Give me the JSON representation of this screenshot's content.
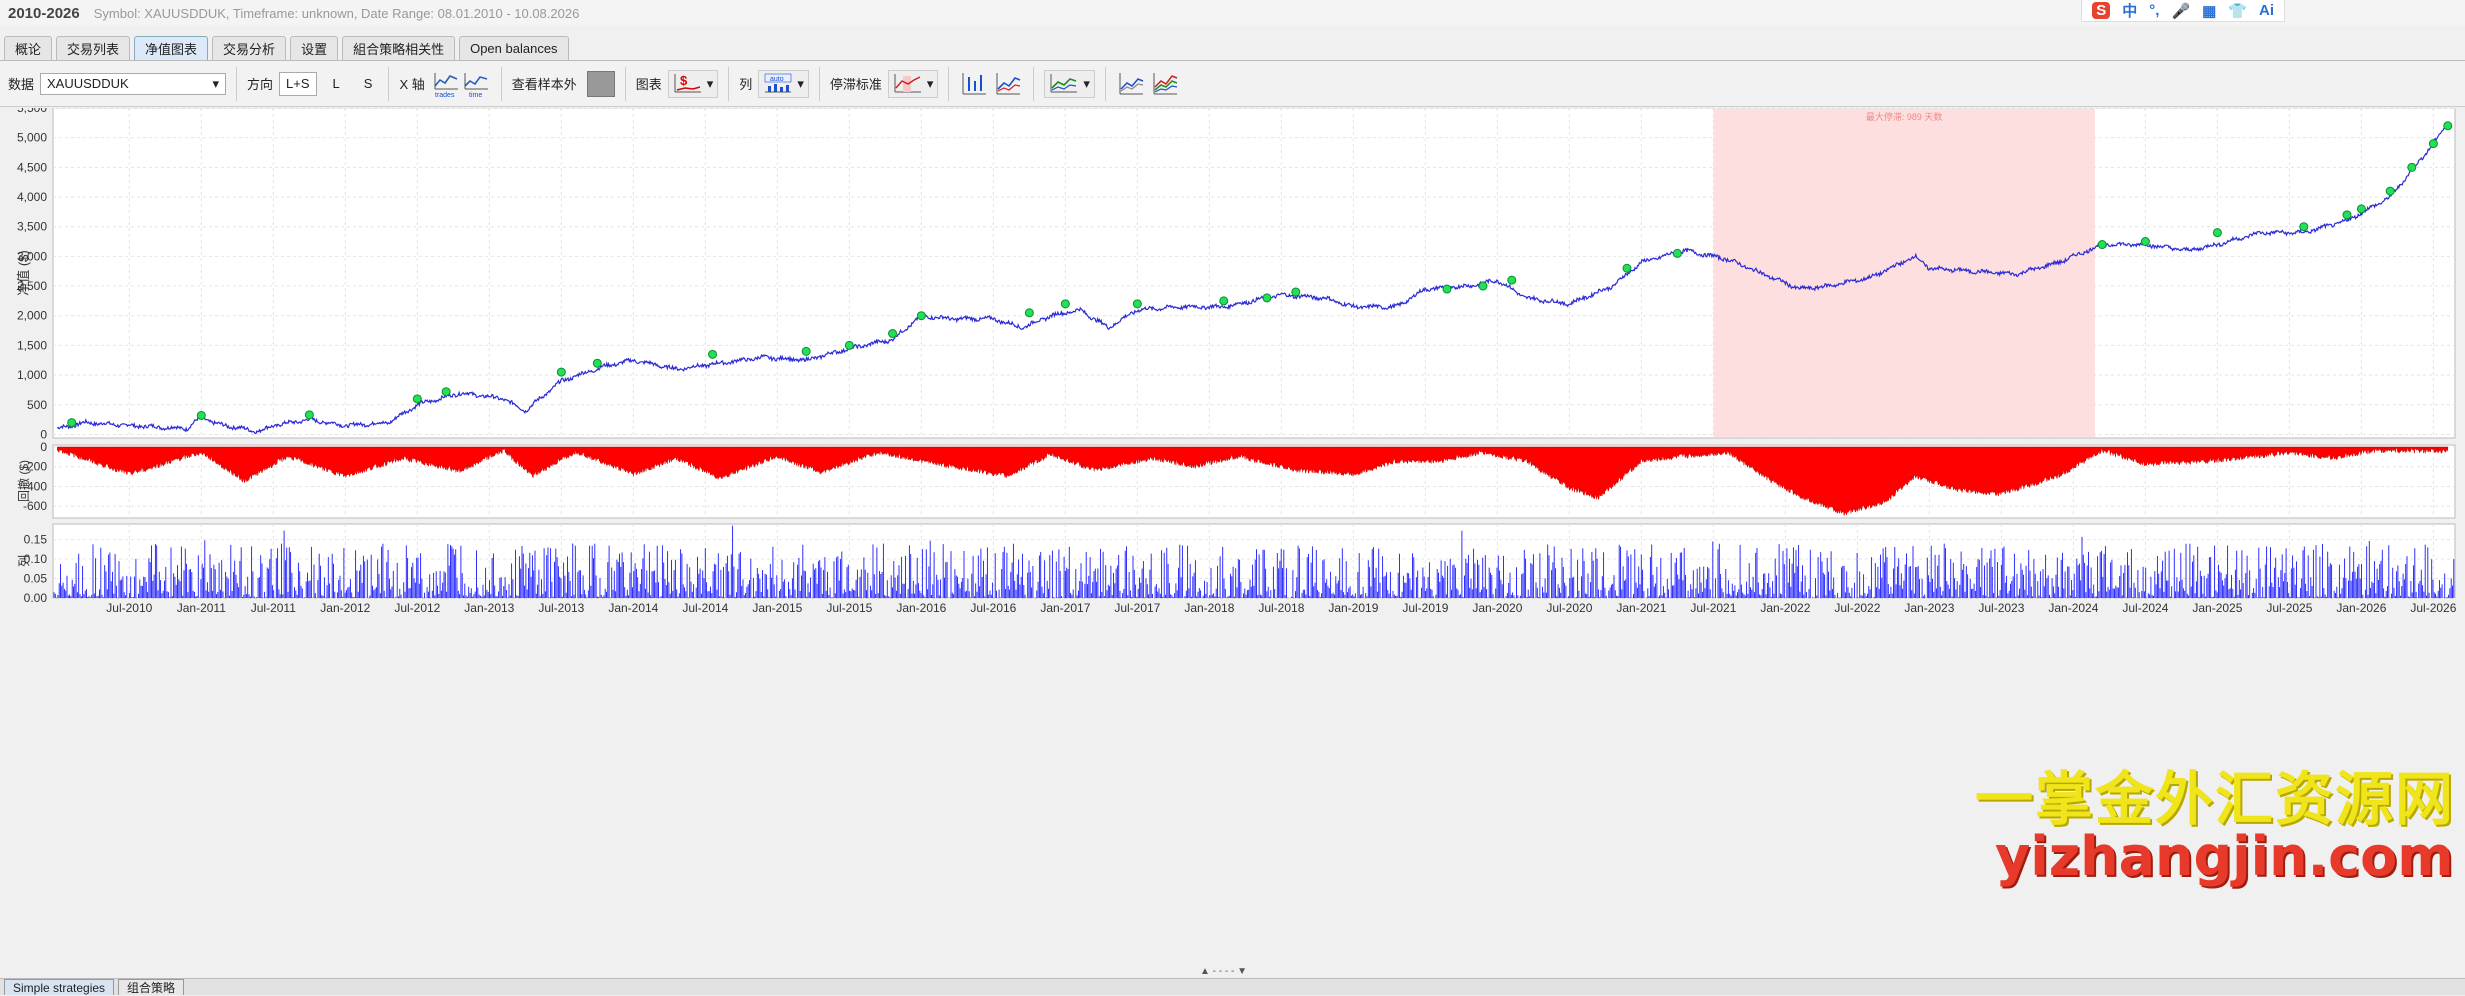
{
  "window": {
    "title": "2010-2026",
    "subtitle": "Symbol: XAUUSDDUK, Timeframe: unknown, Date Range: 08.01.2010 - 10.08.2026"
  },
  "ime": {
    "logo": "S",
    "items": [
      "中",
      "°,",
      "🎤",
      "▦",
      "👕",
      "Ai"
    ]
  },
  "tabs": [
    {
      "label": "概论",
      "active": false
    },
    {
      "label": "交易列表",
      "active": false
    },
    {
      "label": "净值图表",
      "active": true
    },
    {
      "label": "交易分析",
      "active": false
    },
    {
      "label": "设置",
      "active": false
    },
    {
      "label": "組合策略相关性",
      "active": false
    },
    {
      "label": "Open balances",
      "active": false
    }
  ],
  "toolbar": {
    "data_label": "数据",
    "data_value": "XAUUSDDUK",
    "direction_label": "方向",
    "direction_options": [
      "L+S",
      "L",
      "S"
    ],
    "direction_selected": "L+S",
    "xaxis_label": "X 轴",
    "xaxis_trades": "trades",
    "xaxis_time": "time",
    "oos_label": "查看样本外",
    "chart_label": "图表",
    "chart_icon": "$",
    "column_label": "列",
    "column_icon": "auto",
    "stagnation_label": "停滞标准"
  },
  "chart_data": {
    "type": "line",
    "title": "",
    "x_ticks": [
      "Jul-2010",
      "Jan-2011",
      "Jul-2011",
      "Jan-2012",
      "Jul-2012",
      "Jan-2013",
      "Jul-2013",
      "Jan-2014",
      "Jul-2014",
      "Jan-2015",
      "Jul-2015",
      "Jan-2016",
      "Jul-2016",
      "Jan-2017",
      "Jul-2017",
      "Jan-2018",
      "Jul-2018",
      "Jan-2019",
      "Jul-2019",
      "Jan-2020",
      "Jul-2020",
      "Jan-2021",
      "Jul-2021",
      "Jan-2022",
      "Jul-2022",
      "Jan-2023",
      "Jul-2023",
      "Jan-2024",
      "Jul-2024",
      "Jan-2025",
      "Jul-2025",
      "Jan-2026",
      "Jul-2026"
    ],
    "equity": {
      "ylabel": "净值 ($)",
      "ylim": [
        -100,
        5500
      ],
      "yticks": [
        "5,500",
        "5,000",
        "4,500",
        "4,000",
        "3,500",
        "3,000",
        "2,500",
        "2,000",
        "1,500",
        "1,000",
        "500",
        "0"
      ],
      "series": [
        {
          "color": "#2b2bd6",
          "x": [
            2010.0,
            2010.2,
            2010.5,
            2010.9,
            2011.0,
            2011.1,
            2011.4,
            2011.5,
            2011.75,
            2012.0,
            2012.3,
            2012.5,
            2012.8,
            2013.1,
            2013.25,
            2013.5,
            2013.8,
            2014.0,
            2014.3,
            2014.6,
            2014.9,
            2015.2,
            2015.5,
            2015.8,
            2016.0,
            2016.2,
            2016.5,
            2016.7,
            2016.9,
            2017.1,
            2017.3,
            2017.5,
            2017.8,
            2018.1,
            2018.3,
            2018.5,
            2018.8,
            2019.0,
            2019.3,
            2019.5,
            2019.8,
            2020.0,
            2020.2,
            2020.5,
            2020.8,
            2021.0,
            2021.3,
            2021.6,
            2021.9,
            2022.1,
            2022.3,
            2022.6,
            2022.9,
            2023.0,
            2023.3,
            2023.6,
            2023.9,
            2024.2,
            2024.5,
            2024.8,
            2025.0,
            2025.3,
            2025.6,
            2025.9,
            2026.2,
            2026.5,
            2026.6
          ],
          "y": [
            100,
            200,
            150,
            100,
            300,
            180,
            50,
            150,
            250,
            150,
            200,
            500,
            700,
            600,
            400,
            900,
            1150,
            1250,
            1100,
            1200,
            1300,
            1250,
            1450,
            1600,
            2000,
            1950,
            1950,
            1800,
            2000,
            2100,
            1800,
            2100,
            2150,
            2150,
            2250,
            2350,
            2300,
            2150,
            2150,
            2450,
            2500,
            2600,
            2300,
            2200,
            2500,
            2900,
            3100,
            2950,
            2650,
            2450,
            2500,
            2650,
            3000,
            2800,
            2750,
            2700,
            2900,
            3200,
            3200,
            3100,
            3200,
            3400,
            3400,
            3600,
            4000,
            4900,
            5250
          ],
          "new_highs_x": [
            2010.1,
            2011.0,
            2011.75,
            2012.5,
            2012.7,
            2013.5,
            2013.75,
            2014.55,
            2015.2,
            2015.5,
            2015.8,
            2016.0,
            2016.75,
            2017.0,
            2017.5,
            2018.1,
            2018.4,
            2018.6,
            2019.65,
            2019.9,
            2020.1,
            2020.9,
            2021.25,
            2024.2,
            2024.5,
            2025.0,
            2025.6,
            2025.9,
            2026.0,
            2026.2,
            2026.35,
            2026.5,
            2026.6
          ],
          "new_highs_y": [
            200,
            320,
            330,
            600,
            720,
            1050,
            1200,
            1350,
            1400,
            1500,
            1700,
            2000,
            2050,
            2200,
            2200,
            2250,
            2300,
            2400,
            2450,
            2500,
            2600,
            2800,
            3050,
            3200,
            3250,
            3400,
            3500,
            3700,
            3800,
            4100,
            4500,
            4900,
            5200
          ]
        }
      ],
      "stagnation": {
        "x_start": 2021.5,
        "x_end": 2024.15,
        "label": "最大停滞: 989 天数"
      }
    },
    "drawdown": {
      "ylabel": "回撤 ($)",
      "ylim": [
        -700,
        0
      ],
      "yticks": [
        "0",
        "-200",
        "-400",
        "-600"
      ],
      "color": "#ff0000",
      "x": [
        2010.0,
        2010.5,
        2011.0,
        2011.3,
        2011.6,
        2012.0,
        2012.4,
        2012.8,
        2013.1,
        2013.3,
        2013.6,
        2014.0,
        2014.3,
        2014.6,
        2015.0,
        2015.3,
        2015.7,
        2016.2,
        2016.6,
        2016.9,
        2017.2,
        2017.6,
        2017.9,
        2018.2,
        2018.6,
        2019.0,
        2019.3,
        2019.6,
        2019.9,
        2020.2,
        2020.5,
        2020.7,
        2021.0,
        2021.3,
        2021.6,
        2021.9,
        2022.1,
        2022.4,
        2022.7,
        2022.9,
        2023.2,
        2023.5,
        2023.9,
        2024.2,
        2024.5,
        2024.8,
        2025.1,
        2025.5,
        2025.8,
        2026.1,
        2026.6
      ],
      "y": [
        -30,
        -280,
        -60,
        -350,
        -100,
        -300,
        -120,
        -250,
        -40,
        -300,
        -50,
        -280,
        -120,
        -320,
        -100,
        -260,
        -60,
        -200,
        -300,
        -80,
        -240,
        -120,
        -200,
        -100,
        -240,
        -280,
        -150,
        -150,
        -60,
        -150,
        -420,
        -520,
        -150,
        -100,
        -60,
        -350,
        -500,
        -680,
        -560,
        -300,
        -440,
        -480,
        -300,
        -40,
        -180,
        -160,
        -130,
        -60,
        -120,
        -40,
        -50
      ]
    },
    "column": {
      "ylabel": "列",
      "ylim": [
        0,
        0.19
      ],
      "yticks": [
        "0.15",
        "0.10",
        "0.05",
        "0.00"
      ],
      "color": "#1a1aff"
    }
  },
  "bottom_tabs": [
    {
      "label": "Simple strategies",
      "active": true
    },
    {
      "label": "组合策略",
      "active": false
    }
  ],
  "watermark": {
    "line1": "一掌金外汇资源网",
    "line2": "yizhangjin.com"
  }
}
